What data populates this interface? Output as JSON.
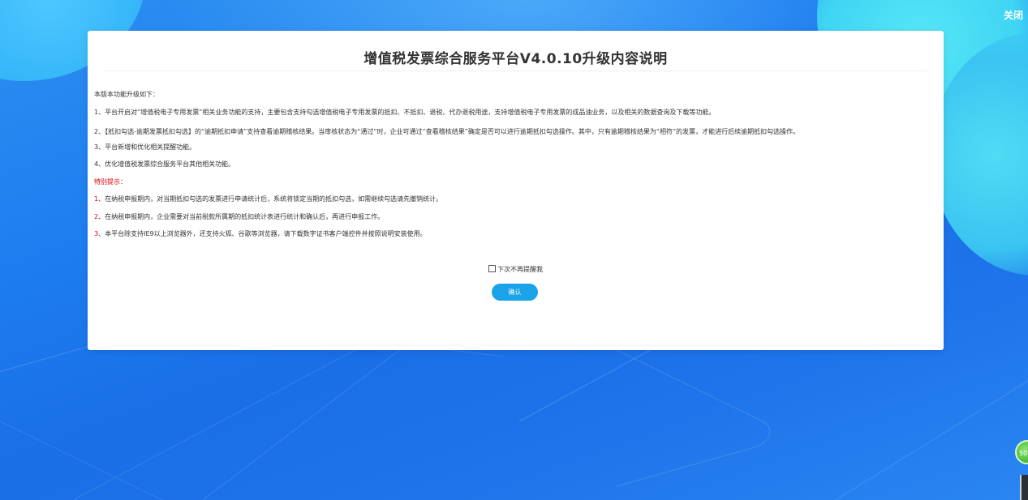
{
  "topbar": {
    "close_label": "关闭"
  },
  "dialog": {
    "title": "增值税发票综合服务平台V4.0.10升级内容说明",
    "intro": "本版本功能升级如下：",
    "items": [
      "1、平台开启对“增值税电子专用发票”相关业务功能的支持，主要包含支持勾选增值税电子专用发票的抵扣、不抵扣、退税、代办退税用途，支持增值税电子专用发票的成品油业务，以及相关的数据查询及下载等功能。",
      "2、【抵扣勾选-逾期发票抵扣勾选】的“逾期抵扣申请”支持查看逾期稽核结果。当审核状态为“通过”时，企业可通过“查看稽核结果”确定是否可以进行逾期抵扣勾选操作。其中，只有逾期稽核结果为“相符”的发票，才能进行后续逾期抵扣勾选操作。",
      "3、平台新增和优化相关提醒功能。",
      "4、优化增值税发票综合服务平台其他相关功能。"
    ],
    "special_title": "特别提示：",
    "special_items": [
      {
        "num": "1",
        "text": "、在纳税申报期内，对当期抵扣勾选的发票进行申请统计后，系统将锁定当期的抵扣勾选，如需继续勾选请先撤销统计。"
      },
      {
        "num": "2",
        "text": "、在纳税申报期内，企业需要对当前税款所属期的抵扣统计表进行统计和确认后，再进行申报工作。"
      },
      {
        "num": "3",
        "text": "、本平台除支持IE9以上浏览器外，还支持火狐、谷歌等浏览器，请下载数字证书客户端控件并按照说明安装使用。"
      }
    ],
    "dont_remind_label": "下次不再提醒我",
    "dont_remind_checked": false,
    "confirm_label": "确认"
  },
  "badge": {
    "text": "50"
  },
  "colors": {
    "background": "#1d7ef0",
    "accent_button": "#1aa3e8",
    "warning_text": "#e00000"
  }
}
